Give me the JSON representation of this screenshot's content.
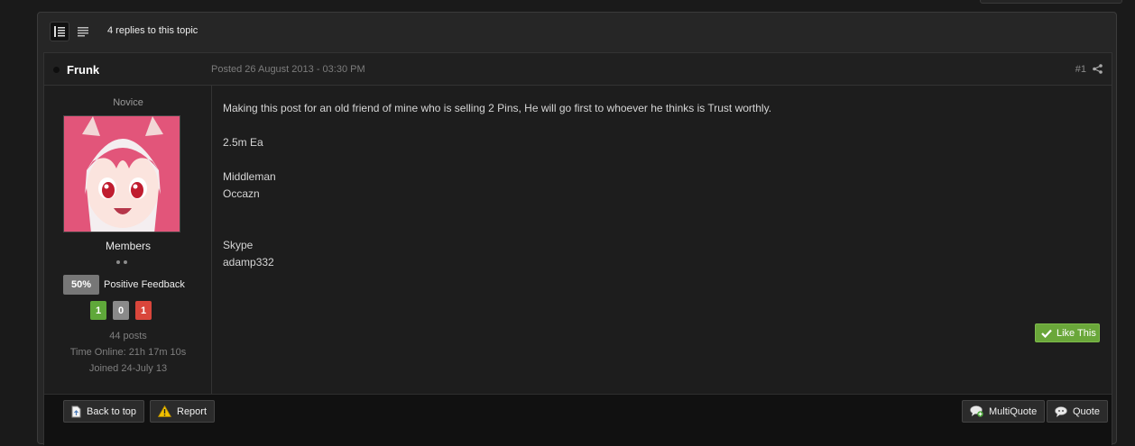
{
  "topic": {
    "replies_label": "4 replies to this topic"
  },
  "post": {
    "author": "Frunk",
    "posted": "Posted 26 August 2013 - 03:30 PM",
    "number": "#1",
    "rank": "Novice",
    "group": "Members",
    "feedback_percent": "50%",
    "feedback_label": "Positive Feedback",
    "feedback_counts": {
      "positive": "1",
      "neutral": "0",
      "negative": "1"
    },
    "posts_count": "44 posts",
    "time_online": "Time Online: 21h 17m 10s",
    "joined": "Joined 24-July 13",
    "body": [
      "Making this post for an old friend of mine who is selling 2 Pins, He will go first to whoever he thinks is Trust worthly.",
      "",
      "2.5m Ea",
      "",
      "Middleman",
      "Occazn",
      "",
      "",
      "Skype",
      "adamp332"
    ],
    "like_label": "Like This"
  },
  "footer": {
    "back_to_top": "Back to top",
    "report": "Report",
    "multiquote": "MultiQuote",
    "quote": "Quote"
  },
  "colors": {
    "page_bg": "#1a1a1a",
    "positive": "#5fa83a",
    "neutral": "#8a8a8a",
    "negative": "#d9463b",
    "like": "#6aa73a"
  },
  "icons": [
    "list-view-icon",
    "text-view-icon",
    "status-dot-icon",
    "share-icon",
    "check-icon",
    "page-icon",
    "warning-icon",
    "multiquote-icon",
    "quote-bubble-icon"
  ]
}
